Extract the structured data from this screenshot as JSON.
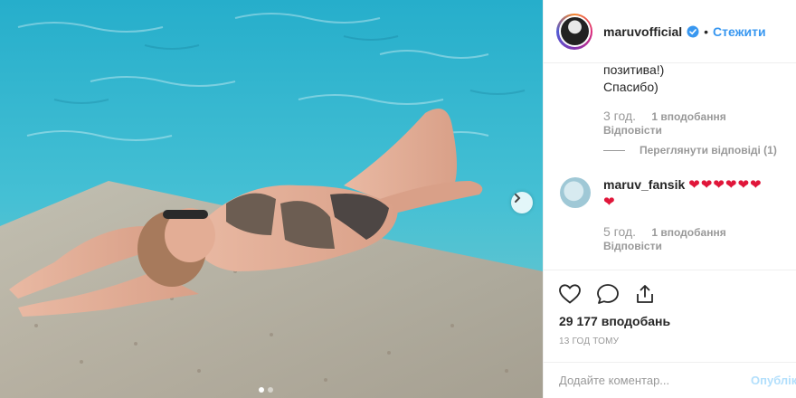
{
  "post": {
    "username": "maruvofficial",
    "follow_label": "Стежити",
    "separator": "•",
    "photo_dots": 2,
    "active_dot": 1
  },
  "comments": [
    {
      "text_lines": [
        "позитива!)",
        "Спасибо)"
      ],
      "time": "3 год.",
      "likes": "1 вподобання",
      "reply_label": "Відповісти",
      "view_replies": "Переглянути відповіді (1)"
    },
    {
      "username": "maruv_fansik",
      "hearts_line1": "❤❤❤❤❤❤",
      "hearts_line2": "❤",
      "time": "5 год.",
      "likes": "1 вподобання",
      "reply_label": "Відповісти"
    }
  ],
  "engagement": {
    "likes_count": "29 177 вподобань",
    "posted_ago": "13 ГОД ТОМУ"
  },
  "add_comment": {
    "placeholder": "Додайте коментар...",
    "publish_label": "Опублікувати"
  },
  "icons": [
    "heart-outline-icon",
    "comment-bubble-icon",
    "share-icon",
    "verified-badge-icon",
    "chevron-right-icon"
  ],
  "colors": {
    "accent": "#3897f0",
    "heart": "#e0163a",
    "muted": "#999999",
    "text": "#262626"
  }
}
